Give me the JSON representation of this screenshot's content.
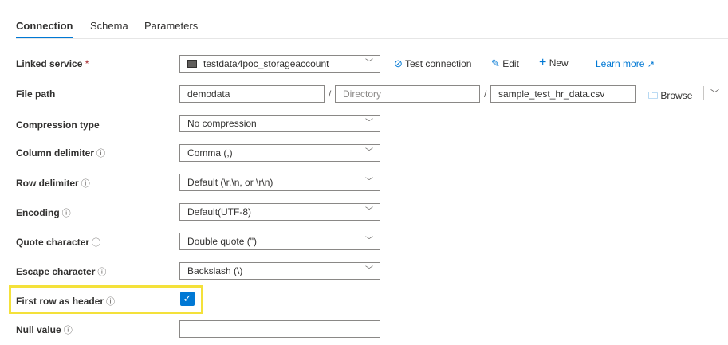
{
  "tabs": [
    "Connection",
    "Schema",
    "Parameters"
  ],
  "form": {
    "linked_service": {
      "label": "Linked service",
      "required": "*",
      "value": "testdata4poc_storageaccount"
    },
    "actions": {
      "test_connection": "Test connection",
      "edit": "Edit",
      "new": "New",
      "learn_more": "Learn more"
    },
    "file_path": {
      "label": "File path",
      "container": "demodata",
      "directory_placeholder": "Directory",
      "file": "sample_test_hr_data.csv",
      "browse": "Browse"
    },
    "compression_type": {
      "label": "Compression type",
      "value": "No compression"
    },
    "column_delimiter": {
      "label": "Column delimiter",
      "value": "Comma (,)"
    },
    "row_delimiter": {
      "label": "Row delimiter",
      "value": "Default (\\r,\\n, or \\r\\n)"
    },
    "encoding": {
      "label": "Encoding",
      "value": "Default(UTF-8)"
    },
    "quote_character": {
      "label": "Quote character",
      "value": "Double quote (\")"
    },
    "escape_character": {
      "label": "Escape character",
      "value": "Backslash (\\)"
    },
    "first_row_header": {
      "label": "First row as header",
      "checked": true
    },
    "null_value": {
      "label": "Null value",
      "value": ""
    }
  },
  "icons": {
    "info": "info-icon",
    "chevron": "chevron-down-icon",
    "storage": "storage-icon",
    "test": "test-connection-icon",
    "edit": "pencil-icon",
    "new": "plus-icon",
    "external": "external-link-icon",
    "folder": "folder-icon",
    "check": "checkmark-icon"
  },
  "colors": {
    "accent": "#0078d4",
    "highlight": "#f4e13a",
    "required": "#a4262c"
  }
}
